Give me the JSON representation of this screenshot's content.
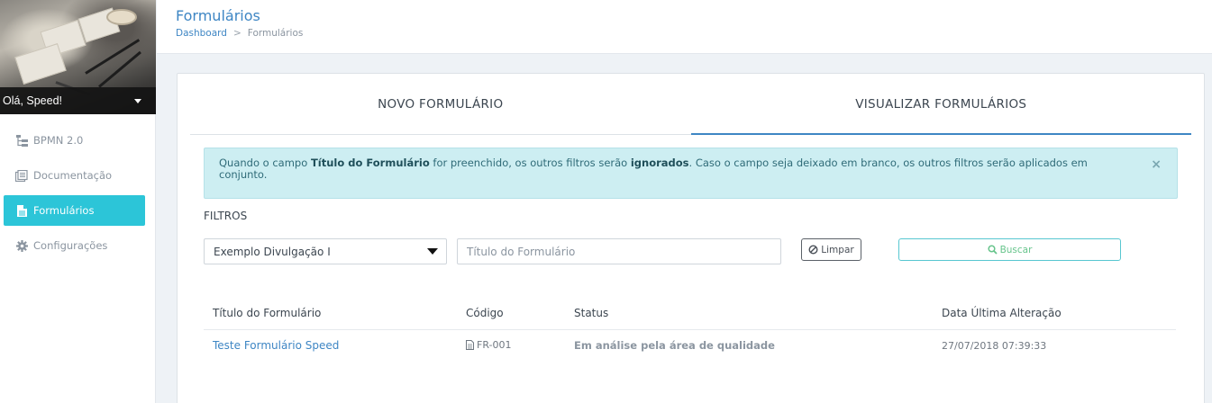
{
  "sidebar": {
    "profile_name": "Olá, Speed!",
    "items": [
      {
        "label": "BPMN 2.0",
        "icon": "hierarchy-icon",
        "active": false
      },
      {
        "label": "Documentação",
        "icon": "documents-icon",
        "active": false
      },
      {
        "label": "Formulários",
        "icon": "file-icon",
        "active": true
      },
      {
        "label": "Configurações",
        "icon": "gear-icon",
        "active": false
      }
    ]
  },
  "header": {
    "title": "Formulários",
    "breadcrumb": {
      "home": "Dashboard",
      "separator": ">",
      "current": "Formulários"
    }
  },
  "tabs": [
    {
      "label": "NOVO FORMULÁRIO",
      "active": false
    },
    {
      "label": "VISUALIZAR FORMULÁRIOS",
      "active": true
    }
  ],
  "alert": {
    "prefix": "Quando o campo ",
    "field": "Título do Formulário",
    "middle": " for preenchido, os outros filtros serão ",
    "emphasis": "ignorados",
    "suffix": ". Caso o campo seja deixado em branco, os outros filtros serão aplicados em conjunto.",
    "close": "×"
  },
  "filters": {
    "label": "FILTROS",
    "select_value": "Exemplo Divulgação I",
    "title_placeholder": "Título do Formulário",
    "clear_label": "Limpar",
    "search_label": "Buscar"
  },
  "table": {
    "headers": [
      "Título do Formulário",
      "Código",
      "Status",
      "Data Última Alteração"
    ],
    "rows": [
      {
        "title": "Teste Formulário Speed",
        "code": "FR-001",
        "status": "Em análise pela área de qualidade",
        "date": "27/07/2018 07:39:33"
      }
    ]
  },
  "colors": {
    "accent": "#2cc5d8",
    "link": "#3e86c4",
    "alert_bg": "#cdeef2",
    "search_text": "#67c48c"
  }
}
